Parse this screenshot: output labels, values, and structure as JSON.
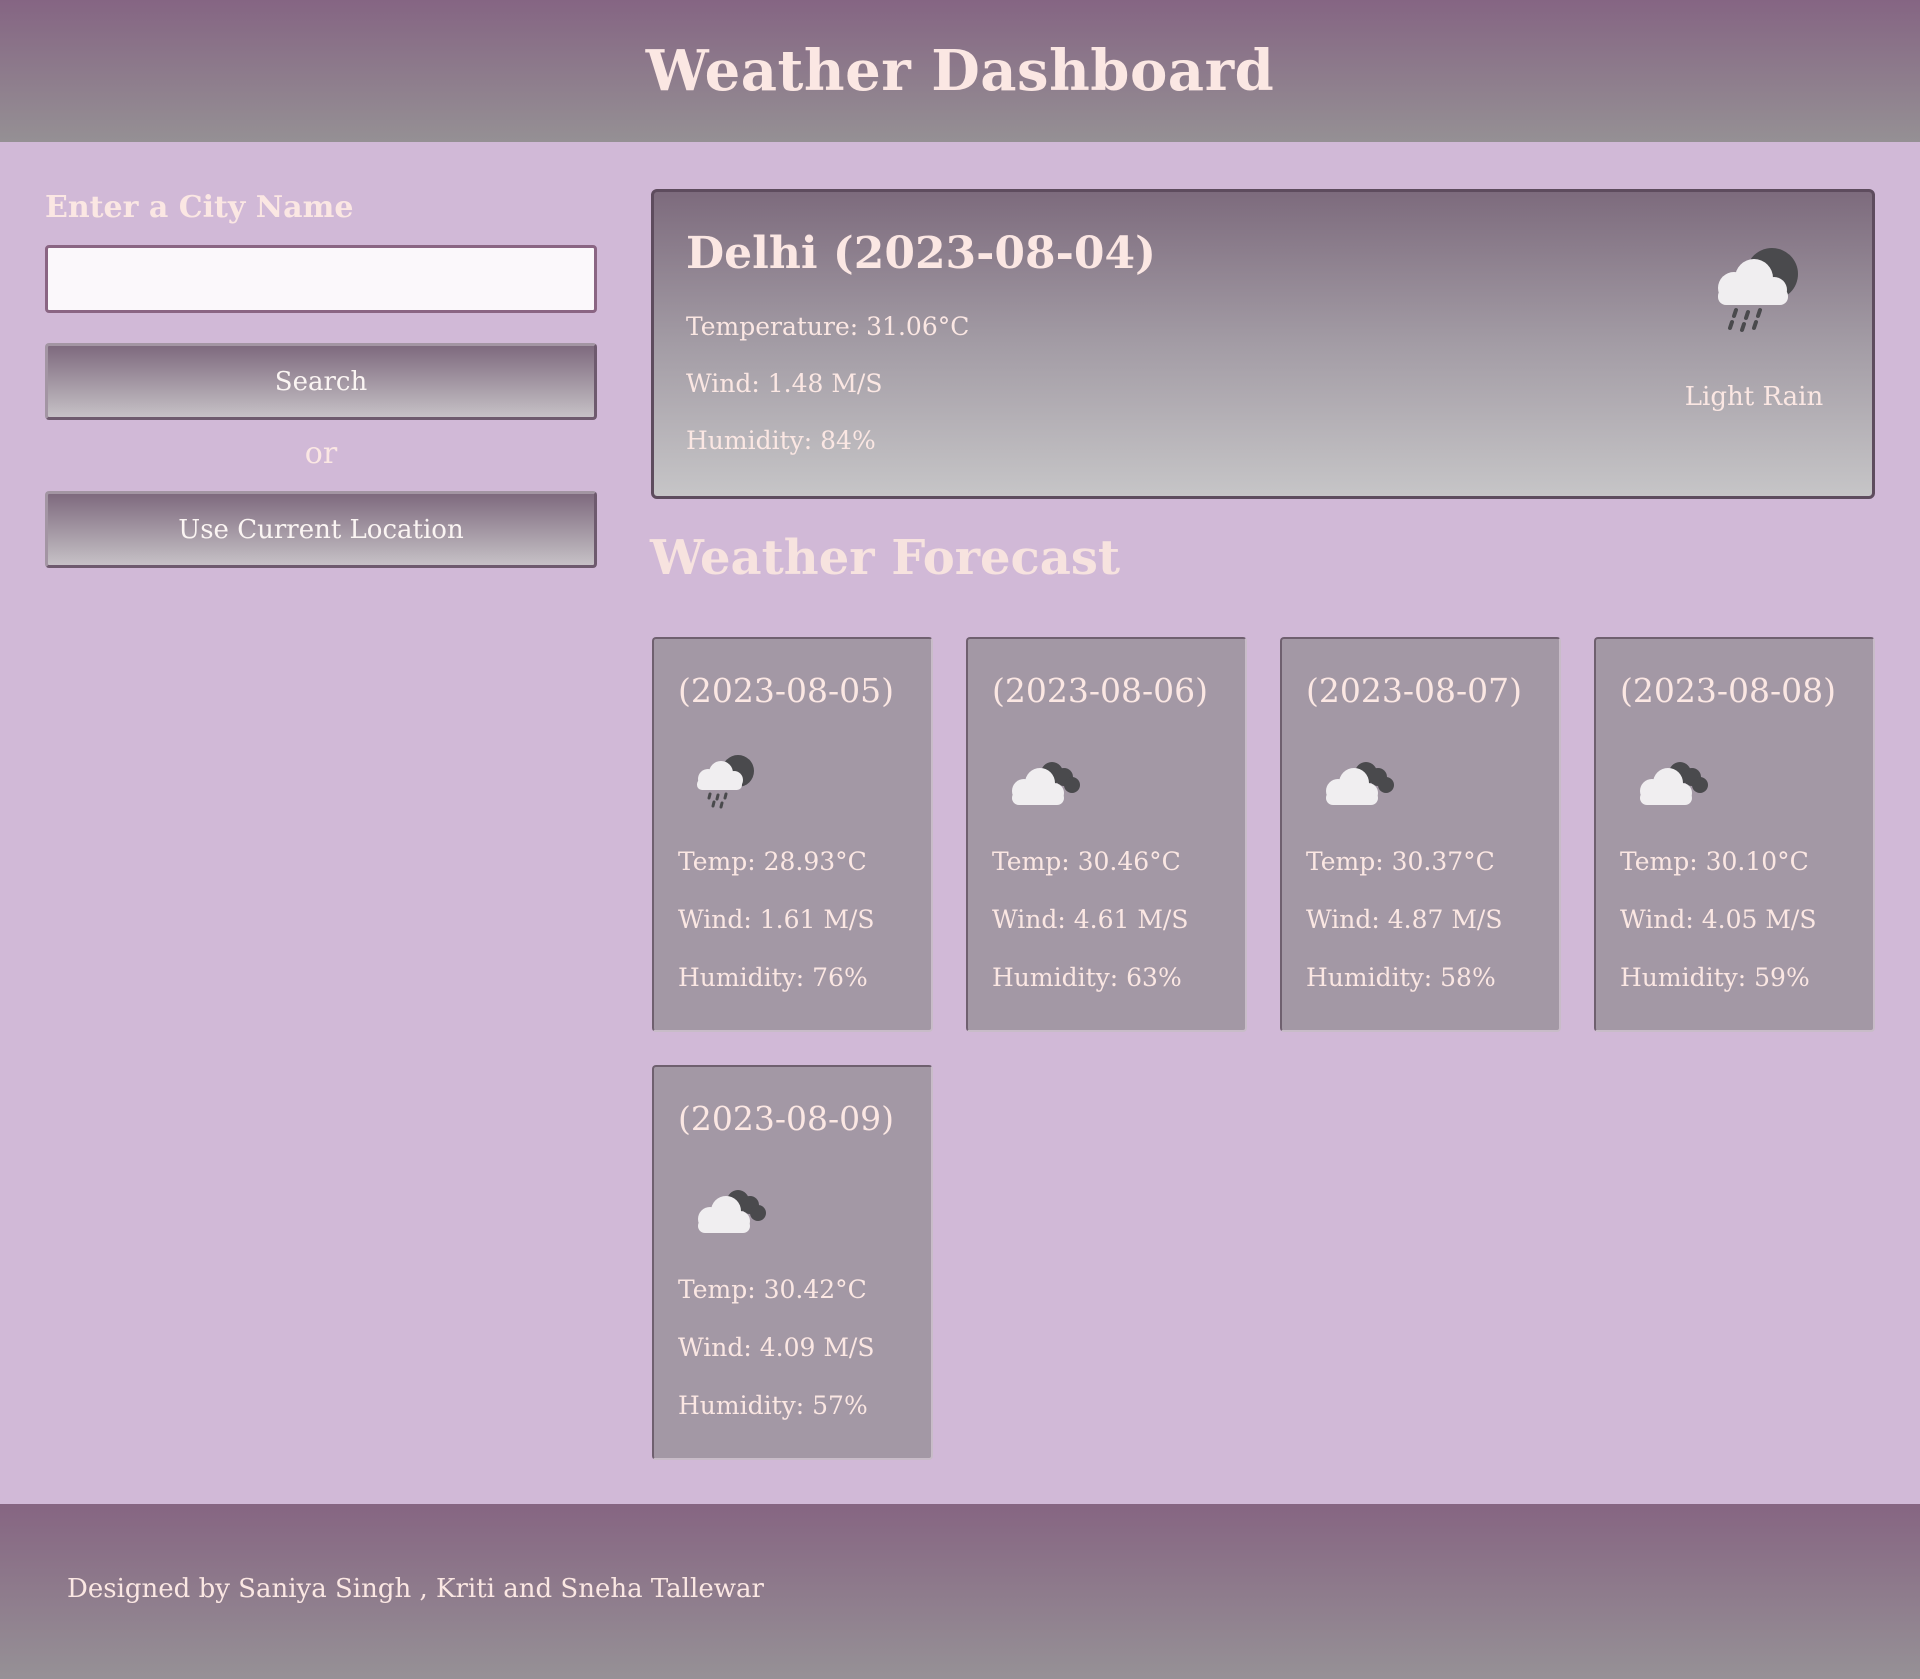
{
  "header": {
    "title": "Weather Dashboard"
  },
  "sidebar": {
    "label": "Enter a City Name",
    "input_value": "",
    "input_placeholder": "",
    "search_label": "Search",
    "or_text": "or",
    "location_label": "Use Current Location"
  },
  "current": {
    "city_date": "Delhi (2023-08-04)",
    "temperature": "Temperature: 31.06°C",
    "wind": "Wind: 1.48 M/S",
    "humidity": "Humidity: 84%",
    "icon": "light-rain-icon",
    "description": "Light Rain"
  },
  "forecast": {
    "title": "Weather Forecast",
    "days": [
      {
        "date": "(2023-08-05)",
        "icon": "light-rain-icon",
        "temp": "Temp: 28.93°C",
        "wind": "Wind: 1.61 M/S",
        "humidity": "Humidity: 76%"
      },
      {
        "date": "(2023-08-06)",
        "icon": "broken-clouds-icon",
        "temp": "Temp: 30.46°C",
        "wind": "Wind: 4.61 M/S",
        "humidity": "Humidity: 63%"
      },
      {
        "date": "(2023-08-07)",
        "icon": "broken-clouds-icon",
        "temp": "Temp: 30.37°C",
        "wind": "Wind: 4.87 M/S",
        "humidity": "Humidity: 58%"
      },
      {
        "date": "(2023-08-08)",
        "icon": "broken-clouds-icon",
        "temp": "Temp: 30.10°C",
        "wind": "Wind: 4.05 M/S",
        "humidity": "Humidity: 59%"
      },
      {
        "date": "(2023-08-09)",
        "icon": "broken-clouds-icon",
        "temp": "Temp: 30.42°C",
        "wind": "Wind: 4.09 M/S",
        "humidity": "Humidity: 57%"
      }
    ]
  },
  "footer": {
    "credit": "Designed by Saniya Singh , Kriti and Sneha Tallewar"
  },
  "colors": {
    "background": "#d1b9d7",
    "header": "#856583",
    "card": "#a398a5",
    "text": "#fbe7e3"
  }
}
